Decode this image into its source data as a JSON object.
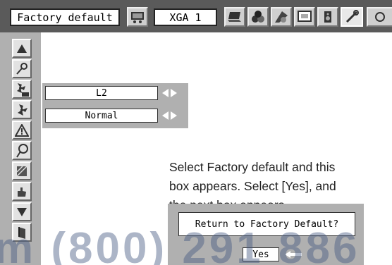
{
  "topbar": {
    "menu_label": "Factory default",
    "source_label": "XGA 1",
    "icons": [
      "computer-input-icon",
      "laptop-icon",
      "balls-icon",
      "palette-icon",
      "screen-icon",
      "speaker-icon",
      "tools-icon",
      "more-icon"
    ]
  },
  "sidebar": {
    "items": [
      "arrow-up-icon",
      "key-icon",
      "fan-off-icon",
      "fan-icon",
      "warning-icon",
      "lamp-icon",
      "filter-icon",
      "hand-icon",
      "arrow-down-icon",
      "exit-icon"
    ]
  },
  "settings": {
    "row1_value": "L2",
    "row2_value": "Normal"
  },
  "instructions": {
    "line1": "Select Factory default and this",
    "line2": "box appears. Select [Yes], and",
    "line3": "the next box appears."
  },
  "dialog": {
    "question": "Return to Factory Default?",
    "yes_label": "Yes"
  },
  "watermark": "m (800) 291 886",
  "colors": {
    "bar_dark": "#5a5a5a",
    "panel_gray": "#b0b0b0",
    "button_light": "#e2e2e2"
  }
}
